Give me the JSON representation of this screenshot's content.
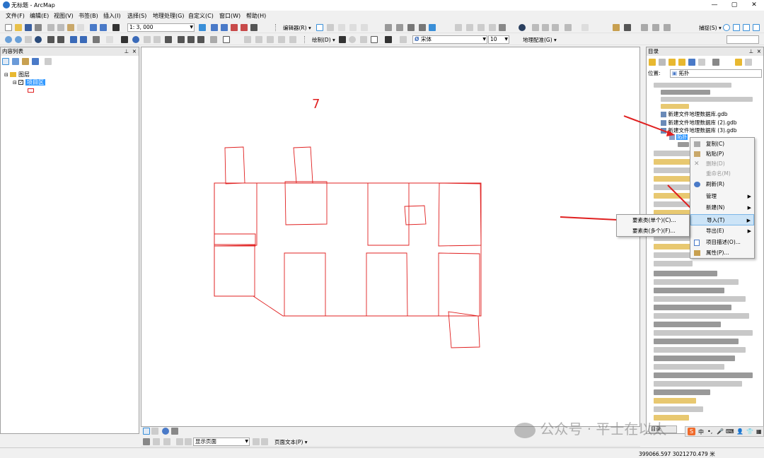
{
  "window": {
    "title": "无标题 - ArcMap",
    "minimize": "—",
    "maximize": "▢",
    "close": "✕"
  },
  "menubar": [
    "文件(F)",
    "编辑(E)",
    "视图(V)",
    "书签(B)",
    "插入(I)",
    "选择(S)",
    "地理处理(G)",
    "自定义(C)",
    "窗口(W)",
    "帮助(H)"
  ],
  "toolbar1": {
    "scale": "1: 3, 000",
    "editor": "编辑器(R) ▾",
    "snapping": "捕捉(S) ▾"
  },
  "toolbar2": {
    "draw": "绘制(D) ▾",
    "font_name": "宋体",
    "font_size": "10",
    "georef": "地理配准(G) ▾"
  },
  "toc": {
    "title": "内容列表",
    "layers_root": "图层",
    "layer_name": "项目区"
  },
  "map": {
    "label": "7",
    "layout_nav": "显示页面",
    "page_text": "页面文本(P) ▾"
  },
  "catalog": {
    "title": "目录",
    "location_label": "位置:",
    "location_value": "拓扑",
    "gdbs": [
      "新建文件地理数据库.gdb",
      "新建文件地理数据库 (2).gdb",
      "新建文件地理数据库 (3).gdb"
    ],
    "selected_item": "拓扑",
    "tab": "目录"
  },
  "context_menu": {
    "items": [
      "复制(C)",
      "粘贴(P)",
      "删除(D)",
      "重命名(M)",
      "刷新(R)",
      "管理",
      "新建(N)",
      "导入(T)",
      "导出(E)",
      "项目描述(O)...",
      "属性(P)..."
    ]
  },
  "import_submenu": {
    "items": [
      "要素类(单个)(C)...",
      "要素类(多个)(F)..."
    ]
  },
  "statusbar": {
    "coords": "399066.597  3021270.479 米"
  },
  "watermark": "公众号 · 平士在以太",
  "colors": {
    "accent_red": "#e02020",
    "selection_blue": "#3399ff",
    "menu_highlight": "#cce4f7"
  }
}
